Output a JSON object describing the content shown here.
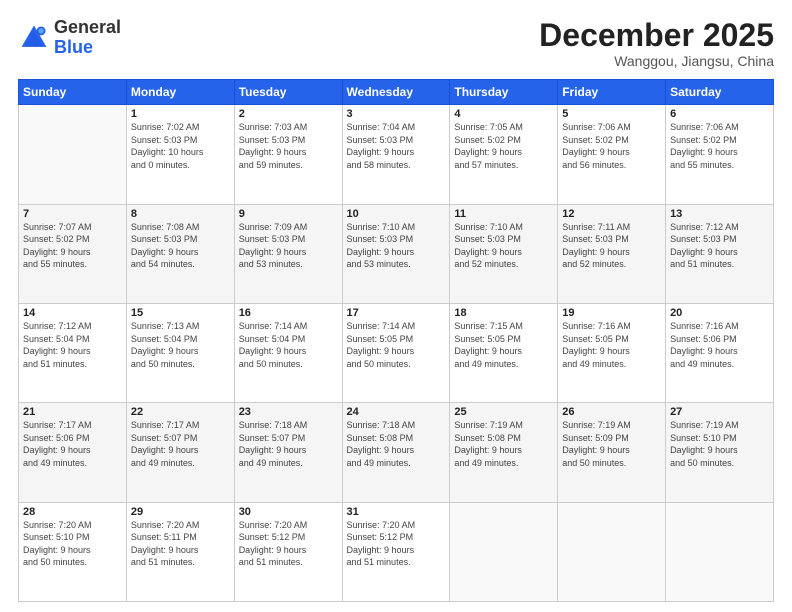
{
  "header": {
    "logo_general": "General",
    "logo_blue": "Blue",
    "month_title": "December 2025",
    "location": "Wanggou, Jiangsu, China"
  },
  "weekdays": [
    "Sunday",
    "Monday",
    "Tuesday",
    "Wednesday",
    "Thursday",
    "Friday",
    "Saturday"
  ],
  "weeks": [
    [
      {
        "day": "",
        "info": ""
      },
      {
        "day": "1",
        "info": "Sunrise: 7:02 AM\nSunset: 5:03 PM\nDaylight: 10 hours\nand 0 minutes."
      },
      {
        "day": "2",
        "info": "Sunrise: 7:03 AM\nSunset: 5:03 PM\nDaylight: 9 hours\nand 59 minutes."
      },
      {
        "day": "3",
        "info": "Sunrise: 7:04 AM\nSunset: 5:03 PM\nDaylight: 9 hours\nand 58 minutes."
      },
      {
        "day": "4",
        "info": "Sunrise: 7:05 AM\nSunset: 5:02 PM\nDaylight: 9 hours\nand 57 minutes."
      },
      {
        "day": "5",
        "info": "Sunrise: 7:06 AM\nSunset: 5:02 PM\nDaylight: 9 hours\nand 56 minutes."
      },
      {
        "day": "6",
        "info": "Sunrise: 7:06 AM\nSunset: 5:02 PM\nDaylight: 9 hours\nand 55 minutes."
      }
    ],
    [
      {
        "day": "7",
        "info": "Sunrise: 7:07 AM\nSunset: 5:02 PM\nDaylight: 9 hours\nand 55 minutes."
      },
      {
        "day": "8",
        "info": "Sunrise: 7:08 AM\nSunset: 5:03 PM\nDaylight: 9 hours\nand 54 minutes."
      },
      {
        "day": "9",
        "info": "Sunrise: 7:09 AM\nSunset: 5:03 PM\nDaylight: 9 hours\nand 53 minutes."
      },
      {
        "day": "10",
        "info": "Sunrise: 7:10 AM\nSunset: 5:03 PM\nDaylight: 9 hours\nand 53 minutes."
      },
      {
        "day": "11",
        "info": "Sunrise: 7:10 AM\nSunset: 5:03 PM\nDaylight: 9 hours\nand 52 minutes."
      },
      {
        "day": "12",
        "info": "Sunrise: 7:11 AM\nSunset: 5:03 PM\nDaylight: 9 hours\nand 52 minutes."
      },
      {
        "day": "13",
        "info": "Sunrise: 7:12 AM\nSunset: 5:03 PM\nDaylight: 9 hours\nand 51 minutes."
      }
    ],
    [
      {
        "day": "14",
        "info": "Sunrise: 7:12 AM\nSunset: 5:04 PM\nDaylight: 9 hours\nand 51 minutes."
      },
      {
        "day": "15",
        "info": "Sunrise: 7:13 AM\nSunset: 5:04 PM\nDaylight: 9 hours\nand 50 minutes."
      },
      {
        "day": "16",
        "info": "Sunrise: 7:14 AM\nSunset: 5:04 PM\nDaylight: 9 hours\nand 50 minutes."
      },
      {
        "day": "17",
        "info": "Sunrise: 7:14 AM\nSunset: 5:05 PM\nDaylight: 9 hours\nand 50 minutes."
      },
      {
        "day": "18",
        "info": "Sunrise: 7:15 AM\nSunset: 5:05 PM\nDaylight: 9 hours\nand 49 minutes."
      },
      {
        "day": "19",
        "info": "Sunrise: 7:16 AM\nSunset: 5:05 PM\nDaylight: 9 hours\nand 49 minutes."
      },
      {
        "day": "20",
        "info": "Sunrise: 7:16 AM\nSunset: 5:06 PM\nDaylight: 9 hours\nand 49 minutes."
      }
    ],
    [
      {
        "day": "21",
        "info": "Sunrise: 7:17 AM\nSunset: 5:06 PM\nDaylight: 9 hours\nand 49 minutes."
      },
      {
        "day": "22",
        "info": "Sunrise: 7:17 AM\nSunset: 5:07 PM\nDaylight: 9 hours\nand 49 minutes."
      },
      {
        "day": "23",
        "info": "Sunrise: 7:18 AM\nSunset: 5:07 PM\nDaylight: 9 hours\nand 49 minutes."
      },
      {
        "day": "24",
        "info": "Sunrise: 7:18 AM\nSunset: 5:08 PM\nDaylight: 9 hours\nand 49 minutes."
      },
      {
        "day": "25",
        "info": "Sunrise: 7:19 AM\nSunset: 5:08 PM\nDaylight: 9 hours\nand 49 minutes."
      },
      {
        "day": "26",
        "info": "Sunrise: 7:19 AM\nSunset: 5:09 PM\nDaylight: 9 hours\nand 50 minutes."
      },
      {
        "day": "27",
        "info": "Sunrise: 7:19 AM\nSunset: 5:10 PM\nDaylight: 9 hours\nand 50 minutes."
      }
    ],
    [
      {
        "day": "28",
        "info": "Sunrise: 7:20 AM\nSunset: 5:10 PM\nDaylight: 9 hours\nand 50 minutes."
      },
      {
        "day": "29",
        "info": "Sunrise: 7:20 AM\nSunset: 5:11 PM\nDaylight: 9 hours\nand 51 minutes."
      },
      {
        "day": "30",
        "info": "Sunrise: 7:20 AM\nSunset: 5:12 PM\nDaylight: 9 hours\nand 51 minutes."
      },
      {
        "day": "31",
        "info": "Sunrise: 7:20 AM\nSunset: 5:12 PM\nDaylight: 9 hours\nand 51 minutes."
      },
      {
        "day": "",
        "info": ""
      },
      {
        "day": "",
        "info": ""
      },
      {
        "day": "",
        "info": ""
      }
    ]
  ]
}
